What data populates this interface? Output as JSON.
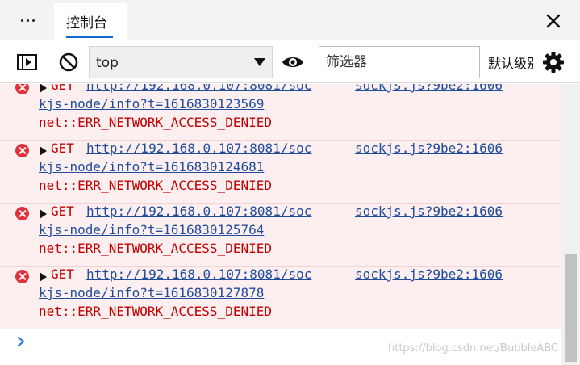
{
  "tabbar": {
    "tab_label": "控制台"
  },
  "toolbar": {
    "context_value": "top",
    "filter_placeholder": "筛选器",
    "levels_label": "默认级别"
  },
  "messages": [
    {
      "method": "GET",
      "url_line1": "http://192.168.0.107:8081/soc",
      "url_line2": "kjs-node/info?t=1616830123569",
      "error": "net::ERR_NETWORK_ACCESS_DENIED",
      "source": "sockjs.js?9be2:1606"
    },
    {
      "method": "GET",
      "url_line1": "http://192.168.0.107:8081/soc",
      "url_line2": "kjs-node/info?t=1616830124681",
      "error": "net::ERR_NETWORK_ACCESS_DENIED",
      "source": "sockjs.js?9be2:1606"
    },
    {
      "method": "GET",
      "url_line1": "http://192.168.0.107:8081/soc",
      "url_line2": "kjs-node/info?t=1616830125764",
      "error": "net::ERR_NETWORK_ACCESS_DENIED",
      "source": "sockjs.js?9be2:1606"
    },
    {
      "method": "GET",
      "url_line1": "http://192.168.0.107:8081/soc",
      "url_line2": "kjs-node/info?t=1616830127878",
      "error": "net::ERR_NETWORK_ACCESS_DENIED",
      "source": "sockjs.js?9be2:1606"
    }
  ],
  "watermark": "https://blog.csdn.net/BubbleABC",
  "colors": {
    "error_bg": "#fdeff0",
    "error_text": "#c40000",
    "link": "#1f4d9c",
    "accent": "#0a6ad8",
    "error_icon": "#e0323d"
  },
  "icons": {
    "more": "more-horizontal-icon",
    "close": "close-icon",
    "sidebar": "sidebar-toggle-icon",
    "clear": "clear-console-icon",
    "live_expression": "eye-icon",
    "settings": "gear-icon",
    "error": "error-circle-icon",
    "expand": "expand-triangle-icon",
    "prompt": "chevron-right-icon"
  }
}
